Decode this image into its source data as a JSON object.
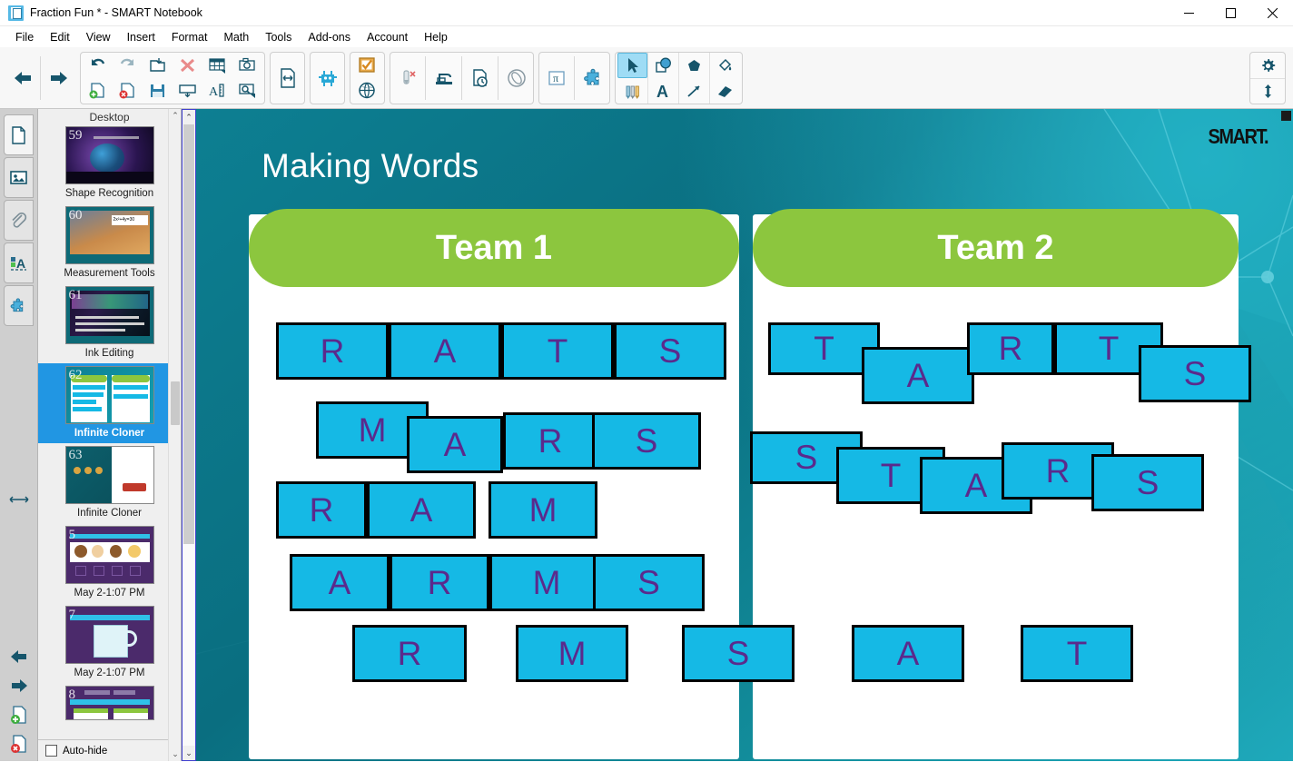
{
  "window": {
    "title": "Fraction Fun * - SMART Notebook",
    "app_icon": "notebook-icon",
    "minimize": "—",
    "maximize": "☐",
    "close": "✕"
  },
  "menu": [
    {
      "label": "File",
      "accel": "F"
    },
    {
      "label": "Edit",
      "accel": "E"
    },
    {
      "label": "View",
      "accel": "V"
    },
    {
      "label": "Insert",
      "accel": "I"
    },
    {
      "label": "Format",
      "accel": "o"
    },
    {
      "label": "Math",
      "accel": "M"
    },
    {
      "label": "Tools",
      "accel": "T"
    },
    {
      "label": "Add-ons",
      "accel": "A"
    },
    {
      "label": "Account",
      "accel": "c"
    },
    {
      "label": "Help",
      "accel": "H"
    }
  ],
  "toolbar": {
    "groups": [
      {
        "name": "navigation",
        "buttons": [
          {
            "name": "previous-page-button",
            "icon": "arrow-left-icon"
          },
          {
            "name": "next-page-button",
            "icon": "arrow-right-icon"
          }
        ]
      },
      {
        "name": "edit-actions",
        "buttons": [
          {
            "name": "undo-button",
            "icon": "undo-icon"
          },
          {
            "name": "add-page-button",
            "icon": "page-add-icon"
          },
          {
            "name": "redo-button",
            "icon": "redo-icon"
          },
          {
            "name": "delete-page-button",
            "icon": "page-delete-icon"
          },
          {
            "name": "open-button",
            "icon": "folder-open-icon"
          },
          {
            "name": "save-button",
            "icon": "save-icon"
          },
          {
            "name": "delete-button",
            "icon": "delete-x-icon"
          },
          {
            "name": "screen-shade-button",
            "icon": "screen-shade-icon"
          },
          {
            "name": "insert-table-button",
            "icon": "table-icon"
          },
          {
            "name": "measurement-tools-button",
            "icon": "ruler-protractor-icon"
          },
          {
            "name": "screen-capture-button",
            "icon": "camera-icon"
          },
          {
            "name": "screen-capture-area-button",
            "icon": "screen-capture-icon"
          }
        ]
      },
      {
        "name": "layout",
        "buttons": [
          {
            "name": "fit-page-button",
            "icon": "fit-width-icon"
          }
        ]
      },
      {
        "name": "addons",
        "buttons": [
          {
            "name": "lab-activity-button",
            "icon": "creature-icon"
          }
        ]
      },
      {
        "name": "response",
        "buttons": [
          {
            "name": "response-button",
            "icon": "checkbox-check-icon"
          },
          {
            "name": "browser-button",
            "icon": "globe-icon"
          }
        ]
      },
      {
        "name": "ink-tools",
        "buttons": [
          {
            "name": "clear-ink-button",
            "icon": "pen-clear-icon"
          },
          {
            "name": "document-camera-button",
            "icon": "document-camera-icon"
          },
          {
            "name": "page-recorder-button",
            "icon": "page-record-icon"
          },
          {
            "name": "protractor-button",
            "icon": "protractor-icon"
          }
        ]
      },
      {
        "name": "math-addons",
        "buttons": [
          {
            "name": "math-button",
            "icon": "pi-icon"
          },
          {
            "name": "puzzle-addon-button",
            "icon": "puzzle-icon"
          }
        ]
      },
      {
        "name": "drawing-tools",
        "buttons": [
          {
            "name": "select-tool-button",
            "icon": "cursor-arrow-icon",
            "selected": true
          },
          {
            "name": "pens-tool-button",
            "icon": "pens-icon"
          },
          {
            "name": "shapes-tool-button",
            "icon": "shapes-circle-square-icon"
          },
          {
            "name": "text-tool-button",
            "icon": "text-a-icon"
          },
          {
            "name": "shape-pen-button",
            "icon": "pentagon-icon"
          },
          {
            "name": "line-tool-button",
            "icon": "line-arrow-icon"
          },
          {
            "name": "fill-tool-button",
            "icon": "paint-bucket-icon"
          },
          {
            "name": "eraser-tool-button",
            "icon": "eraser-icon"
          }
        ]
      }
    ],
    "right_buttons": [
      {
        "name": "settings-button",
        "icon": "gear-icon"
      },
      {
        "name": "move-toolbar-button",
        "icon": "move-updown-icon"
      }
    ]
  },
  "side_rail": {
    "tabs": [
      {
        "name": "page-sorter-tab",
        "icon": "page-icon",
        "active": true
      },
      {
        "name": "gallery-tab",
        "icon": "image-icon"
      },
      {
        "name": "attachments-tab",
        "icon": "paperclip-icon"
      },
      {
        "name": "properties-tab",
        "icon": "properties-a-icon"
      },
      {
        "name": "addons-tab",
        "icon": "puzzle-icon"
      }
    ],
    "drag_handle": "resize-horizontal-icon",
    "bottom_buttons": [
      {
        "name": "previous-page-side-button",
        "icon": "arrow-left-icon"
      },
      {
        "name": "next-page-side-button",
        "icon": "arrow-right-icon"
      },
      {
        "name": "add-page-side-button",
        "icon": "page-add-icon"
      },
      {
        "name": "delete-page-side-button",
        "icon": "page-delete-icon"
      }
    ]
  },
  "thumbnails": {
    "header": "Desktop",
    "scroll_up": "⌃",
    "scroll_down": "⌄",
    "autohide": {
      "label": "Auto-hide",
      "checked": false
    },
    "items": [
      {
        "number": "59",
        "label": "Shape Recognition",
        "selected": false,
        "style": "space"
      },
      {
        "number": "60",
        "label": "Measurement Tools",
        "selected": false,
        "style": "bridge"
      },
      {
        "number": "61",
        "label": "Ink Editing",
        "selected": false,
        "style": "aurora"
      },
      {
        "number": "62",
        "label": "Infinite Cloner",
        "selected": true,
        "style": "making-words"
      },
      {
        "number": "63",
        "label": "Infinite Cloner",
        "selected": false,
        "style": "coins"
      },
      {
        "number": "5",
        "label": "May 2-1:07 PM",
        "selected": false,
        "style": "kids"
      },
      {
        "number": "7",
        "label": "May 2-1:07 PM",
        "selected": false,
        "style": "jug"
      },
      {
        "number": "8",
        "label": "",
        "selected": false,
        "style": "twopanel"
      }
    ]
  },
  "slide": {
    "title": "Making Words",
    "brand": "SMART",
    "teams": [
      {
        "name": "team-1",
        "header": "Team 1",
        "rows": [
          {
            "letters": [
              "R",
              "A",
              "T",
              "S"
            ],
            "word": "RATS"
          },
          {
            "letters": [
              "M",
              "A",
              "R",
              "S"
            ],
            "word": "MARS"
          },
          {
            "letters": [
              "R",
              "A",
              "M"
            ],
            "word": "RAM"
          },
          {
            "letters": [
              "A",
              "R",
              "M",
              "S"
            ],
            "word": "ARMS"
          }
        ]
      },
      {
        "name": "team-2",
        "header": "Team 2",
        "rows": [
          {
            "letters": [
              "T",
              "A",
              "R",
              "T",
              "S"
            ],
            "word": "TARTS"
          },
          {
            "letters": [
              "S",
              "T",
              "A",
              "R",
              "S"
            ],
            "word": "STARS"
          }
        ]
      }
    ],
    "loose_tiles": [
      "R",
      "M",
      "S",
      "A",
      "T"
    ],
    "colors": {
      "tile_fill": "#15b9e5",
      "tile_text": "#5b2a8c",
      "tile_border": "#000000",
      "team_header": "#8cc63e",
      "background_teal": "#0d7f92"
    }
  },
  "canvas_scrollbar": {
    "up": "⌃",
    "down": "⌄"
  }
}
